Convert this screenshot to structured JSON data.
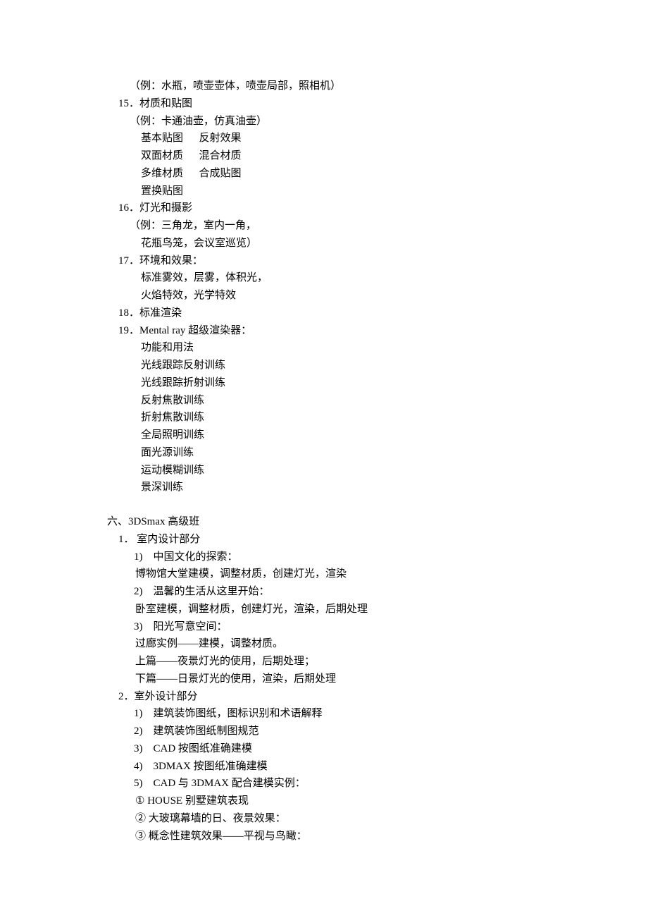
{
  "lines": [
    {
      "cls": "indent-a",
      "text": "（例：水瓶，喷壶壶体，喷壶局部，照相机）"
    },
    {
      "cls": "indent-b",
      "text": "15．材质和贴图"
    },
    {
      "cls": "indent-a",
      "text": "（例：卡通油壶，仿真油壶）"
    },
    {
      "cls": "indent-c",
      "text": "基本贴图      反射效果"
    },
    {
      "cls": "indent-c",
      "text": "双面材质      混合材质"
    },
    {
      "cls": "indent-c",
      "text": "多维材质      合成贴图"
    },
    {
      "cls": "indent-c",
      "text": "置换贴图"
    },
    {
      "cls": "indent-b",
      "text": "16．灯光和摄影"
    },
    {
      "cls": "indent-a",
      "text": "（例：三角龙，室内一角，"
    },
    {
      "cls": "indent-c",
      "text": "花瓶鸟笼，会议室巡览）"
    },
    {
      "cls": "indent-b",
      "text": "17．环境和效果："
    },
    {
      "cls": "indent-c",
      "text": "标准雾效，层雾，体积光，"
    },
    {
      "cls": "indent-c",
      "text": "火焰特效，光学特效"
    },
    {
      "cls": "indent-b",
      "text": "18．标准渲染"
    },
    {
      "cls": "indent-b",
      "text": "19．Mental ray 超级渲染器："
    },
    {
      "cls": "indent-c",
      "text": "功能和用法"
    },
    {
      "cls": "indent-c",
      "text": "光线跟踪反射训练"
    },
    {
      "cls": "indent-c",
      "text": "光线跟踪折射训练"
    },
    {
      "cls": "indent-c",
      "text": "反射焦散训练"
    },
    {
      "cls": "indent-c",
      "text": "折射焦散训练"
    },
    {
      "cls": "indent-c",
      "text": "全局照明训练"
    },
    {
      "cls": "indent-c",
      "text": "面光源训练"
    },
    {
      "cls": "indent-c",
      "text": "运动模糊训练"
    },
    {
      "cls": "indent-c",
      "text": "景深训练"
    },
    {
      "cls": "blank",
      "text": ""
    },
    {
      "cls": "indent-d",
      "text": "六、3DSmax 高级班"
    },
    {
      "cls": "indent-b",
      "text": "1． 室内设计部分"
    },
    {
      "cls": "indent-f",
      "text": "1)    中国文化的探索："
    },
    {
      "cls": "indent-g",
      "text": "博物馆大堂建模，调整材质，创建灯光，渲染"
    },
    {
      "cls": "indent-f",
      "text": "2)    温馨的生活从这里开始："
    },
    {
      "cls": "indent-g",
      "text": "卧室建模，调整材质，创建灯光，渲染，后期处理"
    },
    {
      "cls": "indent-f",
      "text": "3)    阳光写意空间："
    },
    {
      "cls": "indent-g",
      "text": "过廊实例——建模，调整材质。"
    },
    {
      "cls": "indent-g",
      "text": "上篇——夜景灯光的使用，后期处理；"
    },
    {
      "cls": "indent-g",
      "text": "下篇——日景灯光的使用，渲染，后期处理"
    },
    {
      "cls": "indent-b",
      "text": "2．室外设计部分"
    },
    {
      "cls": "indent-f",
      "text": "1)    建筑装饰图纸，图标识别和术语解释"
    },
    {
      "cls": "indent-f",
      "text": "2)    建筑装饰图纸制图规范"
    },
    {
      "cls": "indent-f",
      "text": "3)    CAD 按图纸准确建模"
    },
    {
      "cls": "indent-f",
      "text": "4)    3DMAX 按图纸准确建模"
    },
    {
      "cls": "indent-f",
      "text": "5)    CAD 与 3DMAX 配合建模实例："
    },
    {
      "cls": "indent-g",
      "text": "① HOUSE 别墅建筑表现"
    },
    {
      "cls": "indent-g",
      "text": "② 大玻璃幕墙的日、夜景效果："
    },
    {
      "cls": "indent-g",
      "text": "③ 概念性建筑效果——平视与鸟瞰："
    }
  ]
}
